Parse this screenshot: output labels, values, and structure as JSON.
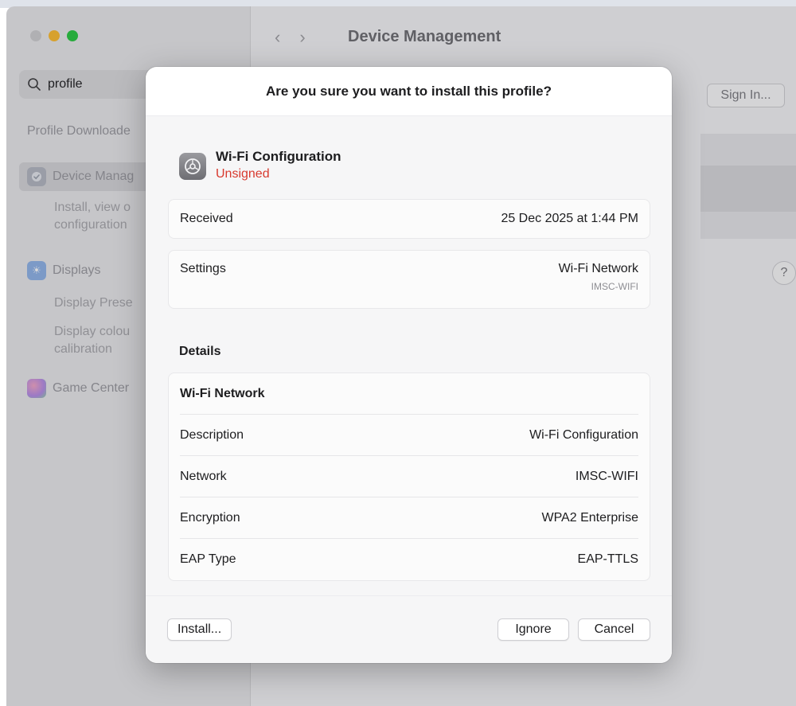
{
  "window": {
    "title": "Device Management",
    "nav_back": "‹",
    "nav_forward": "›",
    "sign_in_label": "Sign In...",
    "help_label": "?"
  },
  "sidebar": {
    "search": {
      "value": "profile",
      "icon": "search-icon"
    },
    "profile_downloaded": "Profile Downloade",
    "device_management": {
      "label": "Device Manag",
      "icon": "gear-badge-icon"
    },
    "device_sub": [
      "Install, view o",
      "configuration"
    ],
    "displays": {
      "label": "Displays",
      "icon": "sun-icon"
    },
    "displays_sub1": "Display Prese",
    "displays_sub2": [
      "Display colou",
      "calibration"
    ],
    "game_center": {
      "label": "Game Center",
      "icon": "game-center-icon"
    }
  },
  "dialog": {
    "title": "Are you sure you want to install this profile?",
    "profile": {
      "name": "Wi-Fi Configuration",
      "status": "Unsigned",
      "icon": "gear-icon"
    },
    "received": {
      "label": "Received",
      "value": "25 Dec 2025 at 1:44 PM"
    },
    "settings": {
      "label": "Settings",
      "value": "Wi-Fi Network",
      "sub": "IMSC-WIFI"
    },
    "details_title": "Details",
    "details": {
      "header": "Wi-Fi Network",
      "rows": [
        {
          "label": "Description",
          "value": "Wi-Fi Configuration"
        },
        {
          "label": "Network",
          "value": "IMSC-WIFI"
        },
        {
          "label": "Encryption",
          "value": "WPA2 Enterprise"
        },
        {
          "label": "EAP Type",
          "value": "EAP-TTLS"
        }
      ]
    },
    "buttons": {
      "install": "Install...",
      "ignore": "Ignore",
      "cancel": "Cancel"
    }
  },
  "colors": {
    "unsigned": "#d83a2f",
    "traffic_min": "#febc2e",
    "traffic_max": "#28c840"
  }
}
